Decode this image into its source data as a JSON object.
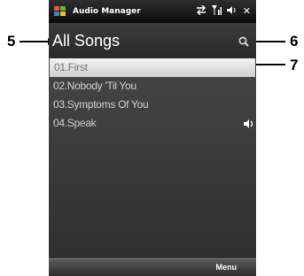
{
  "statusbar": {
    "app_title": "Audio Manager",
    "icons": [
      "connectivity-icon",
      "signal-icon",
      "volume-icon",
      "close-icon"
    ],
    "close_glyph": "✕"
  },
  "header": {
    "title": "All Songs"
  },
  "songs": [
    {
      "label": "01.First",
      "selected": true
    },
    {
      "label": "02.Nobody 'Til You",
      "selected": false
    },
    {
      "label": "03.Symptoms Of You",
      "selected": false
    },
    {
      "label": "04.Speak",
      "selected": false,
      "playing": true
    }
  ],
  "softkeys": {
    "right": "Menu"
  },
  "callouts": [
    "5",
    "6",
    "7"
  ],
  "colors": {
    "header_bg": "#2f2f2f",
    "list_bg": "#444444",
    "selected_bg": "#e6e6e6",
    "text": "#d0d0d0"
  }
}
